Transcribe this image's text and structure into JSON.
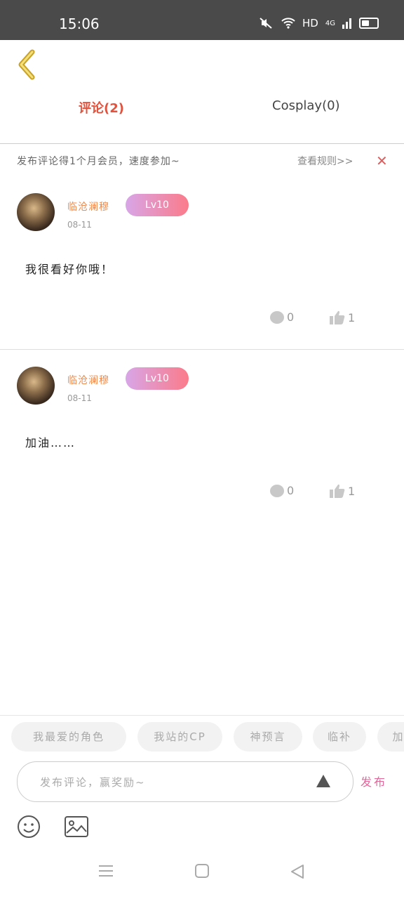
{
  "status_bar": {
    "time": "15:06",
    "network": "HD",
    "signal": "4G"
  },
  "tabs": [
    {
      "label": "评论(2)",
      "active": true
    },
    {
      "label": "Cosplay(0)",
      "active": false
    }
  ],
  "notice": {
    "text": "发布评论得1个月会员，速度参加~",
    "rules_link": "查看规则>>",
    "close": "✕"
  },
  "comments": [
    {
      "username": "临沧澜穆",
      "level": "Lv10",
      "date": "08-11",
      "content": "我很看好你哦！",
      "replies": "0",
      "likes": "1"
    },
    {
      "username": "临沧澜穆",
      "level": "Lv10",
      "date": "08-11",
      "content": "加油……",
      "replies": "0",
      "likes": "1"
    }
  ],
  "chips": [
    "我最爱的角色",
    "我站的CP",
    "神预言",
    "临补",
    "加"
  ],
  "input": {
    "placeholder": "发布评论，赢奖励~",
    "publish_label": "发布"
  },
  "colors": {
    "accent": "#e0533f",
    "username": "#f08a4b",
    "badge_start": "#d8a6e8",
    "badge_end": "#fb7b8a",
    "publish": "#e06a9a"
  }
}
